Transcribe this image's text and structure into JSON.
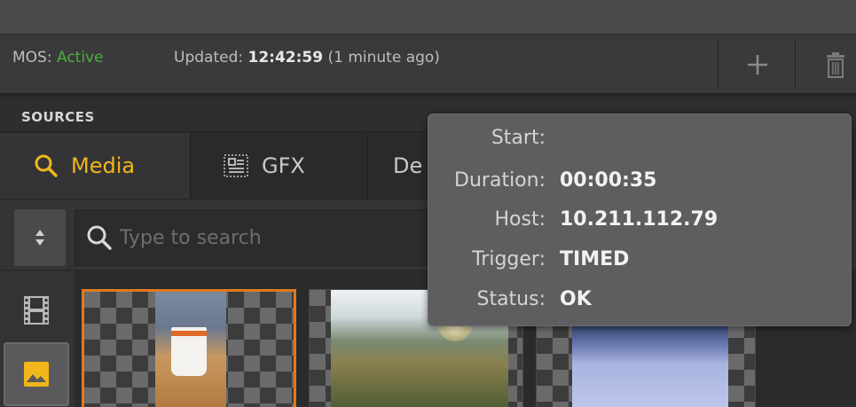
{
  "status": {
    "mos_label": "MOS:",
    "mos_state": "Active",
    "updated_label": "Updated:",
    "updated_time": "12:42:59",
    "updated_relative": "(1 minute ago)",
    "add_icon": "plus-icon",
    "delete_icon": "trash-icon"
  },
  "sources": {
    "title": "SOURCES",
    "tabs": [
      {
        "label": "Media",
        "icon": "search-icon",
        "active": true
      },
      {
        "label": "GFX",
        "icon": "graphics-icon",
        "active": false
      },
      {
        "label": "De",
        "icon": "",
        "active": false
      }
    ],
    "search_placeholder": "Type to search",
    "sidebar": [
      {
        "icon": "film-icon",
        "selected": false
      },
      {
        "icon": "image-icon",
        "selected": true
      }
    ]
  },
  "tooltip": {
    "rows": [
      {
        "label": "Start:",
        "value": ""
      },
      {
        "label": "Duration:",
        "value": "00:00:35"
      },
      {
        "label": "Host:",
        "value": "10.211.112.79"
      },
      {
        "label": "Trigger:",
        "value": "TIMED"
      },
      {
        "label": "Status:",
        "value": "OK"
      }
    ]
  },
  "colors": {
    "accent": "#f0b61a",
    "active_status": "#4caf3a",
    "selection_border": "#e07a1a"
  }
}
